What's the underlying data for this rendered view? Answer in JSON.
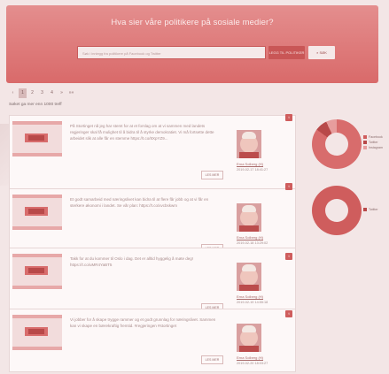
{
  "header": {
    "title": "Hva sier våre politikere på sosiale medier?",
    "search_placeholder": "Søk i innlegg fra politikere på Facebook og Twitter",
    "add_politician": "LEGG TIL POLITIKER",
    "search_label": "SØK"
  },
  "pagination": {
    "pages": [
      "‹",
      "1",
      "2",
      "3",
      "4",
      "»",
      "»»"
    ],
    "active_index": 1
  },
  "results": {
    "summary": "Søket ga mer enn 1000 treff"
  },
  "posts": [
    {
      "text": "På Stortinget nå jeg har stemt for at et forslag om at vi sammen med landets regjeringer skal få mulighet til å bidra til å styrke demokratiet. Vi må fortsette dette arbeidet slik at alle får en stemme https://t.co/8XpYZ9...",
      "button": "LES MER",
      "poster": "Erna Solberg (H)",
      "date": "2019-02-17 18:41:27",
      "icon": "twitter-icon"
    },
    {
      "text": "Et godt samarbeid med næringslivet kan bidra til at flere får jobb og at vi får en sterkere økonomi i landet. Se vår plan: https://t.co/xvcbskwm",
      "button": "LES MER",
      "poster": "Erna Solberg (H)",
      "date": "2019-02-18 13:29:02",
      "icon": "twitter-icon"
    },
    {
      "text": "Takk for at du kommer til Oslo i dag. Det er alltid hyggelig å møte deg! https://t.co/uMR4YaBT5",
      "button": "LES MER",
      "poster": "Erna Solberg (H)",
      "date": "2019-02-19 14:55:18",
      "icon": "twitter-icon"
    },
    {
      "text": "Vi jobber for å skape trygge rammer og et godt grunnlag for næringslivet. Sammen kan vi skape en bærekraftig fremtid. #regjeringen #stortinget",
      "button": "LES MER",
      "poster": "Erna Solberg (H)",
      "date": "2019-02-20 18:03:27",
      "icon": "twitter-icon"
    }
  ],
  "charts": [
    {
      "legend": [
        "Facebook",
        "Twitter",
        "Instagram"
      ],
      "icon": "twitter-icon"
    },
    {
      "legend": [
        "Twitter"
      ],
      "icon": "twitter-icon"
    }
  ],
  "colors": {
    "primary": "#d96a6a",
    "accent": "#c95656",
    "background": "#f3e6e6"
  }
}
